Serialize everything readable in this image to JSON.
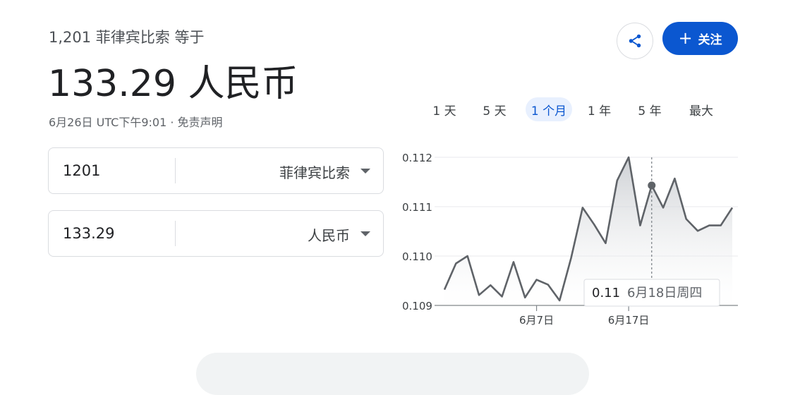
{
  "header": {
    "subhead": "1,201 菲律宾比索 等于",
    "value": "133.29 人民币",
    "timestamp": "6月26日 UTC下午9:01",
    "separator": " · ",
    "disclaimer": "免责声明"
  },
  "actions": {
    "share_icon": "share-icon",
    "follow_label": "关注",
    "follow_icon": "plus-icon",
    "accent": "#0b57d0"
  },
  "ranges": [
    {
      "label": "1 天",
      "active": false
    },
    {
      "label": "5 天",
      "active": false
    },
    {
      "label": "1 个月",
      "active": true
    },
    {
      "label": "1 年",
      "active": false
    },
    {
      "label": "5 年",
      "active": false
    },
    {
      "label": "最大",
      "active": false
    }
  ],
  "converter": {
    "from": {
      "amount": "1201",
      "currency": "菲律宾比索"
    },
    "to": {
      "amount": "133.29",
      "currency": "人民币"
    }
  },
  "tooltip": {
    "value": "0.11",
    "date": "6月18日周四"
  },
  "chart_data": {
    "type": "area",
    "series": [
      {
        "values": [
          0.10932,
          0.10985,
          0.11,
          0.10921,
          0.10941,
          0.10918,
          0.10988,
          0.10916,
          0.10952,
          0.10942,
          0.1091,
          0.10996,
          0.11098,
          0.11064,
          0.11026,
          0.11153,
          0.112,
          0.11062,
          0.11143,
          0.11098,
          0.11157,
          0.11075,
          0.11051,
          0.11062,
          0.11062,
          0.11098
        ]
      }
    ],
    "ylim": [
      0.109,
      0.112
    ],
    "yticks": [
      "0.112",
      "0.111",
      "0.110",
      "0.109"
    ],
    "xticks": [
      {
        "label": "6月7日",
        "index": 8
      },
      {
        "label": "6月17日",
        "index": 16
      }
    ],
    "highlight_index": 18,
    "grid": true,
    "line_color": "#5f6368"
  }
}
